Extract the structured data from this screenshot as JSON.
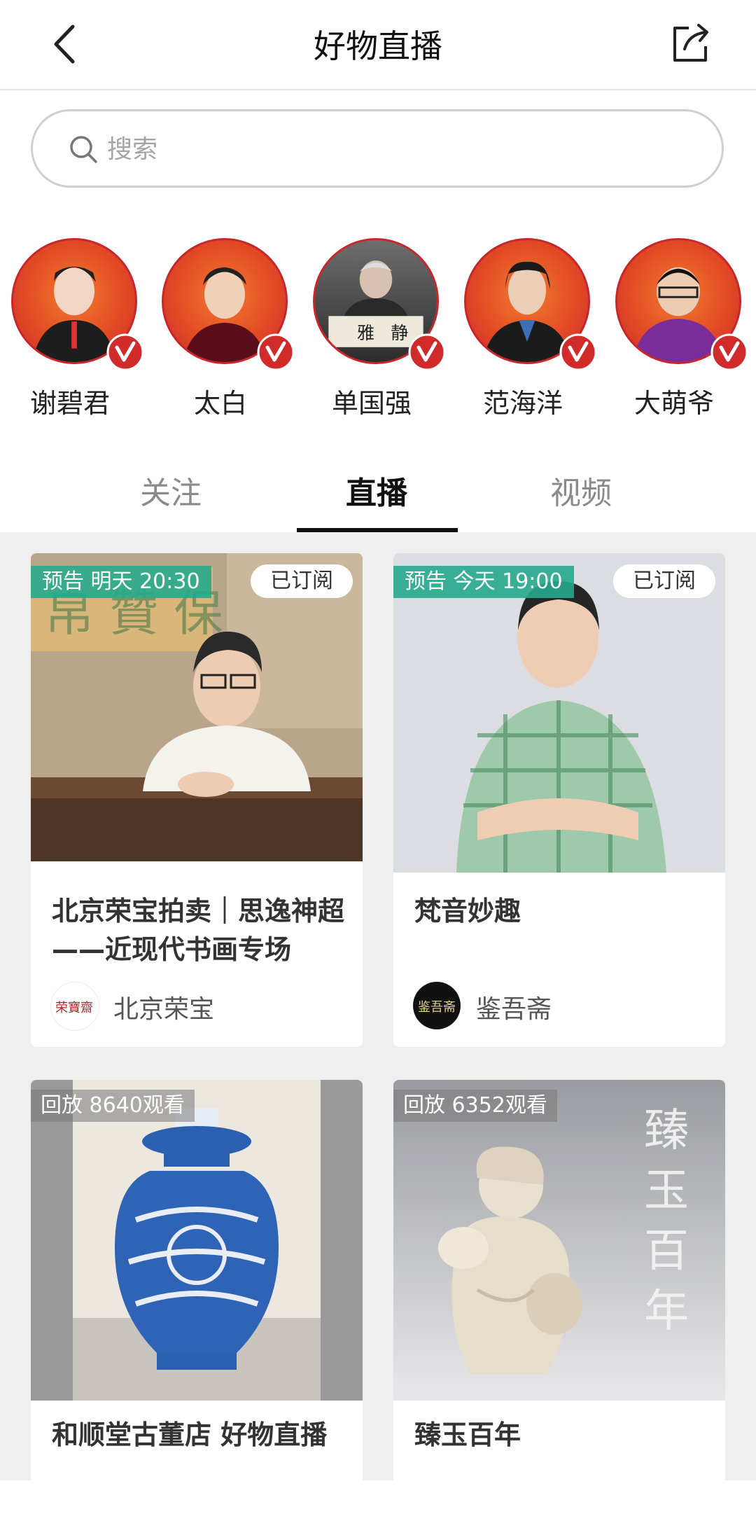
{
  "header": {
    "title": "好物直播"
  },
  "search": {
    "placeholder": "搜索"
  },
  "hosts": [
    {
      "name": "谢碧君"
    },
    {
      "name": "太白"
    },
    {
      "name": "单国强"
    },
    {
      "name": "范海洋"
    },
    {
      "name": "大萌爷"
    }
  ],
  "tabs": [
    {
      "label": "关注",
      "active": false
    },
    {
      "label": "直播",
      "active": true
    },
    {
      "label": "视频",
      "active": false
    }
  ],
  "cards": [
    {
      "tag": "预告 明天 20:30",
      "subscribe_label": "已订阅",
      "title": "北京荣宝拍卖｜思逸神超——近现代书画专场",
      "author": "北京荣宝",
      "author_logo_text": "荣寶齋"
    },
    {
      "tag": "预告 今天 19:00",
      "subscribe_label": "已订阅",
      "title": "梵音妙趣",
      "author": "鉴吾斋",
      "author_logo_text": "鉴吾斋"
    },
    {
      "tag": "回放 8640观看",
      "title": "和顺堂古董店 好物直播"
    },
    {
      "tag": "回放 6352观看",
      "title": "臻玉百年",
      "overlay_text": "臻玉百年"
    }
  ]
}
